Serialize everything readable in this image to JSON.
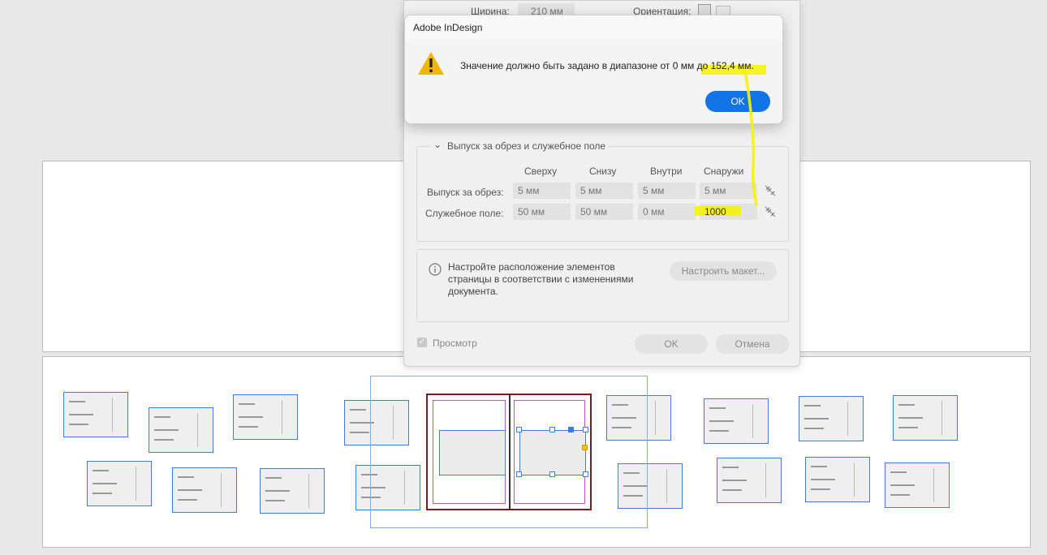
{
  "alert": {
    "title": "Adobe InDesign",
    "message": "Значение должно быть задано в диапазоне от 0 мм до 152,4 мм.",
    "ok_label": "OK",
    "icon": "warning-icon"
  },
  "doc_setup": {
    "width_label": "Ширина:",
    "width_value": "210 мм",
    "orientation_label": "Ориентация:",
    "bleed_section_title": "Выпуск за обрез и служебное поле",
    "columns": [
      "Сверху",
      "Снизу",
      "Внутри",
      "Снаружи"
    ],
    "rows": [
      {
        "label": "Выпуск за обрез:",
        "values": [
          "5 мм",
          "5 мм",
          "5 мм",
          "5 мм"
        ]
      },
      {
        "label": "Служебное поле:",
        "values": [
          "50 мм",
          "50 мм",
          "0 мм",
          "1000"
        ]
      }
    ],
    "info_text": "Настройте расположение элементов страницы в соответствии с изменениями документа.",
    "adjust_layout_label": "Настроить макет...",
    "preview_label": "Просмотр",
    "ok_label": "OK",
    "cancel_label": "Отмена"
  },
  "colors": {
    "accent": "#1473e6",
    "highlight": "#f7f300",
    "selection": "#3a7ee0",
    "margin_guide": "#b05cc8",
    "bleed_guide": "#7a1a1a"
  }
}
